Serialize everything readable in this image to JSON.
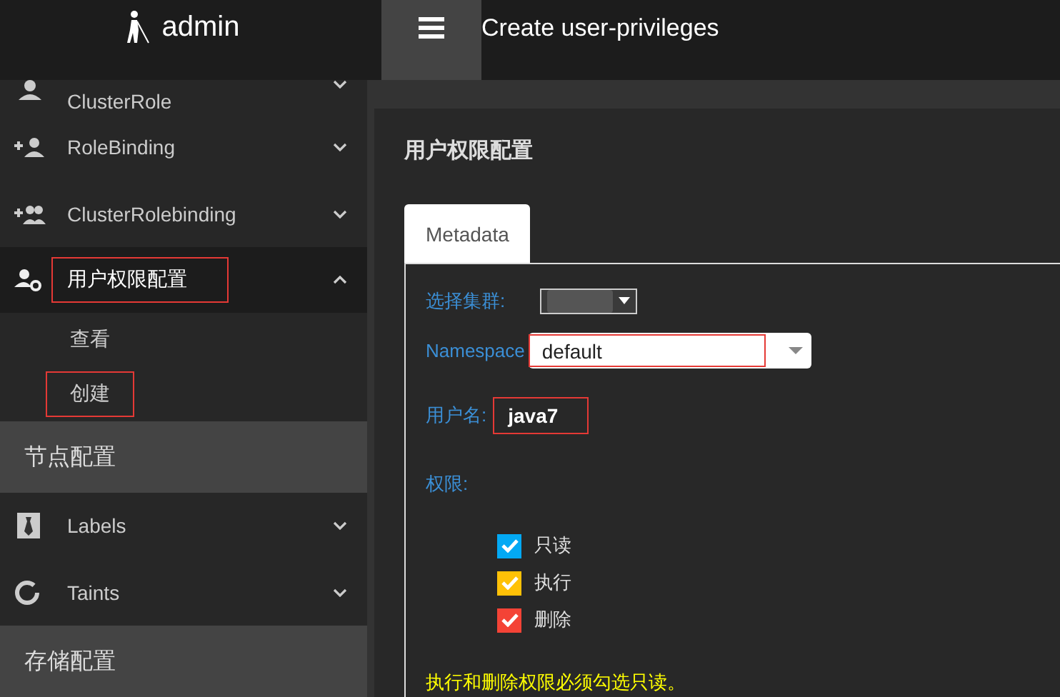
{
  "brand": {
    "title": "admin"
  },
  "header": {
    "title": "Create user-privileges"
  },
  "sidebar": {
    "items": [
      {
        "kind": "item",
        "label": "ClusterRole",
        "expanded": false,
        "selected": false,
        "highlighted": false
      },
      {
        "kind": "item",
        "label": "RoleBinding",
        "expanded": false,
        "selected": false,
        "highlighted": false
      },
      {
        "kind": "item",
        "label": "ClusterRolebinding",
        "expanded": false,
        "selected": false,
        "highlighted": false
      },
      {
        "kind": "item",
        "label": "用户权限配置",
        "expanded": true,
        "selected": true,
        "highlighted": true
      },
      {
        "kind": "subitem",
        "label": "查看",
        "highlighted": false
      },
      {
        "kind": "subitem",
        "label": "创建",
        "highlighted": true
      },
      {
        "kind": "section",
        "label": "节点配置"
      },
      {
        "kind": "item",
        "label": "Labels",
        "expanded": false,
        "selected": false,
        "highlighted": false
      },
      {
        "kind": "item",
        "label": "Taints",
        "expanded": false,
        "selected": false,
        "highlighted": false
      },
      {
        "kind": "section",
        "label": "存储配置"
      }
    ]
  },
  "panel": {
    "title": "用户权限配置",
    "tabs": [
      {
        "label": "Metadata",
        "selected": true
      }
    ],
    "cluster": {
      "label": "选择集群:"
    },
    "namespace": {
      "label": "Namespace",
      "value": "default",
      "highlighted": true
    },
    "username": {
      "label": "用户名:",
      "value": "java7",
      "highlighted": true
    },
    "permissions": {
      "label": "权限:",
      "options": [
        {
          "label": "只读",
          "checked": true,
          "color": "#03a9f4"
        },
        {
          "label": "执行",
          "checked": true,
          "color": "#ffc107"
        },
        {
          "label": "删除",
          "checked": true,
          "color": "#f44336"
        }
      ]
    },
    "notice": "执行和删除权限必须勾选只读。"
  }
}
